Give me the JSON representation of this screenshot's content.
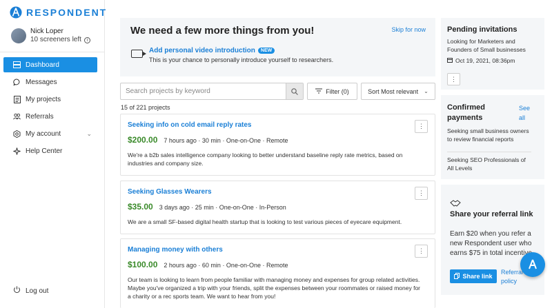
{
  "brand": {
    "name": "RESPONDENT",
    "color": "#1a7fd6",
    "accent": "#1a8fe3",
    "price_color": "#3a8a2a"
  },
  "user": {
    "name": "Nick Loper",
    "screeners": "10 screeners left"
  },
  "nav": {
    "items": [
      {
        "label": "Dashboard",
        "icon": "dashboard-icon"
      },
      {
        "label": "Messages",
        "icon": "message-icon"
      },
      {
        "label": "My projects",
        "icon": "projects-icon"
      },
      {
        "label": "Referrals",
        "icon": "referrals-icon"
      },
      {
        "label": "My account",
        "icon": "account-icon"
      },
      {
        "label": "Help Center",
        "icon": "help-icon"
      }
    ],
    "logout": "Log out"
  },
  "banner": {
    "title": "We need a few more things from you!",
    "skip": "Skip for now",
    "task_title": "Add personal video introduction",
    "task_badge": "NEW",
    "task_sub": "This is your chance to personally introduce yourself to researchers."
  },
  "search": {
    "placeholder": "Search projects by keyword"
  },
  "filter_label": "Filter (0)",
  "sort_label": "Sort Most relevant",
  "count": "15 of 221 projects",
  "projects": [
    {
      "title": "Seeking info on cold email reply rates",
      "price": "$200.00",
      "meta": "7 hours ago · 30 min · One-on-One · Remote",
      "desc": "We're a b2b sales intelligence company looking to better understand baseline reply rate metrics, based on industries and company size."
    },
    {
      "title": "Seeking Glasses Wearers",
      "price": "$35.00",
      "meta": "3 days ago · 25 min · One-on-One · In-Person",
      "desc": "We are a small SF-based digital health startup that is looking to test various pieces of eyecare equipment."
    },
    {
      "title": "Managing money with others",
      "price": "$100.00",
      "meta": "2 hours ago · 60 min · One-on-One · Remote",
      "desc": "Our team is looking to learn from people familiar with managing money and expenses for group related activities. Maybe you've organized a trip with your friends, split the expenses between your roommates or raised money for a charity or a rec sports team. We want to hear from you!"
    }
  ],
  "pending": {
    "title": "Pending invitations",
    "text": "Looking for Marketers and Founders of Small businesses",
    "date": "Oct 19, 2021, 08:36pm"
  },
  "confirmed": {
    "title": "Confirmed payments",
    "see_all": "See all",
    "items": [
      "Seeking small business owners to review financial reports",
      "Seeking SEO Professionals of All Levels"
    ]
  },
  "referral": {
    "title": "Share your referral link",
    "text": "Earn $20 when you refer a new Respondent user who earns $75 in total incentive",
    "share": "Share link",
    "policy": "Referral policy"
  }
}
